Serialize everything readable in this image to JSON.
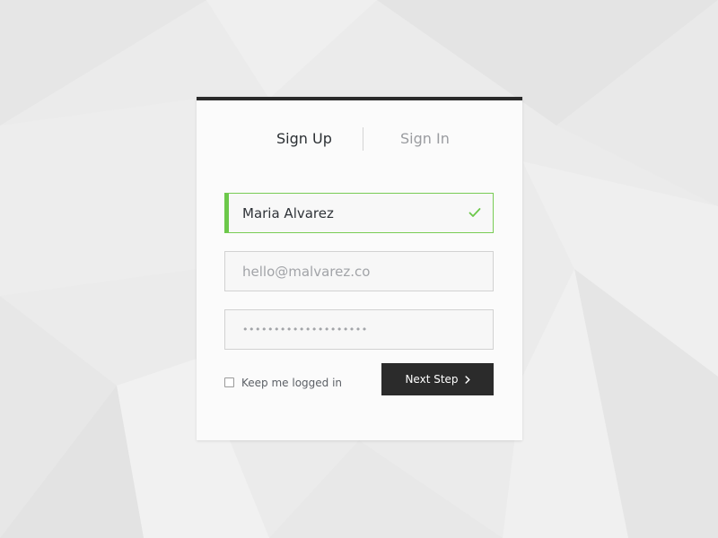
{
  "tabs": {
    "sign_up": "Sign Up",
    "sign_in": "Sign In",
    "active": "sign_up"
  },
  "form": {
    "name_value": "Maria Alvarez",
    "name_valid": true,
    "email_value": "hello@malvarez.co",
    "password_mask": "••••••••••••••••••••",
    "keep_logged_in_label": "Keep me logged in",
    "keep_logged_in_checked": false,
    "next_button_label": "Next Step"
  },
  "icons": {
    "valid": "check-icon",
    "next": "chevron-right-icon"
  },
  "colors": {
    "accent": "#6cc84a",
    "button_bg": "#2b2b2b",
    "card_top_bar": "#2a2a2a",
    "tab_active": "#2b2f33",
    "tab_inactive": "#9a9ca0"
  }
}
